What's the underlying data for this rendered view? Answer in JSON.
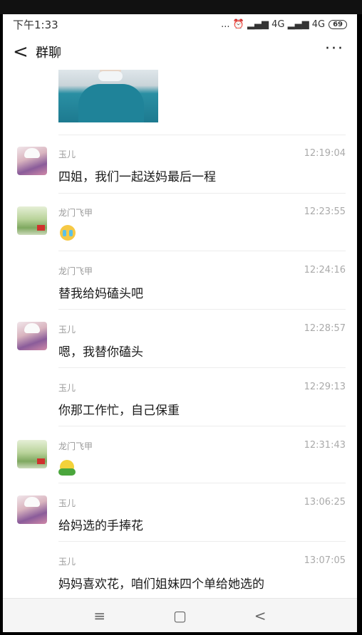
{
  "status_bar": {
    "time": "下午1:33",
    "right": "... ⏰ ▂▄▆ 4G ▂▄▆ 4G",
    "battery": "69"
  },
  "header": {
    "back": "<",
    "title": "群聊",
    "more": "···"
  },
  "messages": [
    {
      "sender": "玉儿",
      "time": "12:19:04",
      "text": "四姐，我们一起送妈最后一程",
      "avatar": "girl"
    },
    {
      "sender": "龙门飞甲",
      "time": "12:23:55",
      "text": "",
      "emoji": "crying-face",
      "avatar": "landscape"
    },
    {
      "sender": "龙门飞甲",
      "time": "12:24:16",
      "text": "替我给妈磕头吧",
      "avatar": ""
    },
    {
      "sender": "玉儿",
      "time": "12:28:57",
      "text": "嗯，我替你磕头",
      "avatar": "girl"
    },
    {
      "sender": "玉儿",
      "time": "12:29:13",
      "text": "你那工作忙，自己保重",
      "avatar": ""
    },
    {
      "sender": "龙门飞甲",
      "time": "12:31:43",
      "text": "",
      "emoji": "frog",
      "avatar": "landscape"
    },
    {
      "sender": "玉儿",
      "time": "13:06:25",
      "text": "给妈选的手捧花",
      "avatar": "girl"
    },
    {
      "sender": "玉儿",
      "time": "13:07:05",
      "text": "妈妈喜欢花，咱们姐妹四个单给她选的",
      "avatar": ""
    }
  ],
  "bottom_nav": {
    "menu": "≡",
    "home": "▢",
    "back": "<"
  }
}
